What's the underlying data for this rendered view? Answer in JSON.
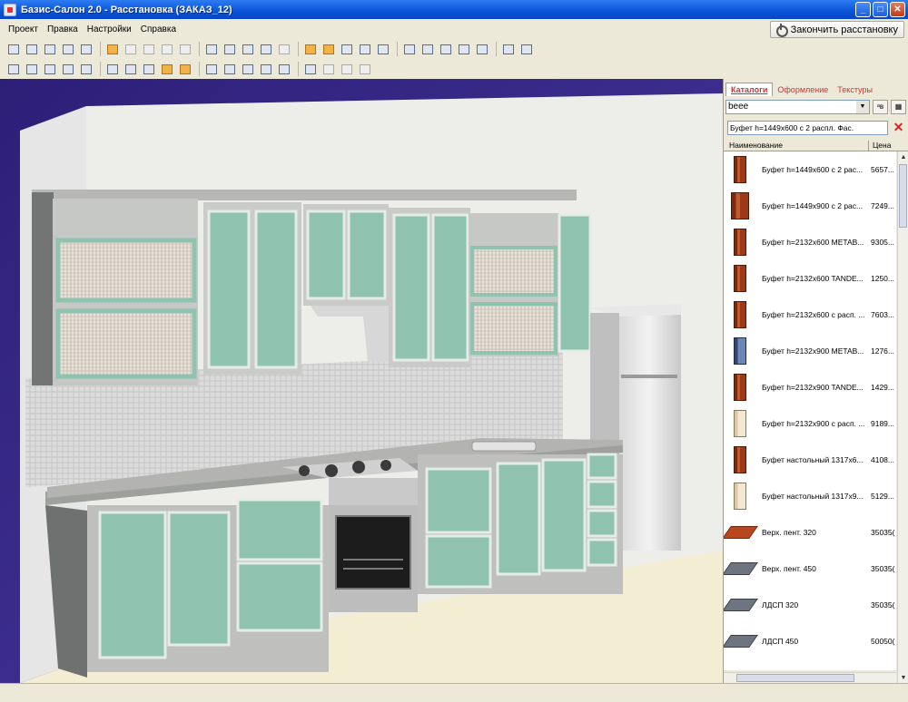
{
  "window": {
    "title": "Базис-Салон 2.0 -  Расстановка (ЗАКАЗ_12)",
    "controls": {
      "minimize": "_",
      "maximize": "□",
      "close": "✕"
    }
  },
  "menu": [
    "Проект",
    "Правка",
    "Настройки",
    "Справка"
  ],
  "finish_button": "Закончить расстановку",
  "toolbar_icons": {
    "row1": [
      "new-icon",
      "open-icon",
      "save-icon",
      "print-icon",
      "home-icon",
      "undo-icon",
      "redo-icon",
      "cut-icon",
      "copy-icon",
      "paste-icon",
      "select-icon",
      "grid-icon",
      "table-icon",
      "chart-icon",
      "dimension-icon",
      "box-icon",
      "shelf-icon",
      "lamp-icon",
      "group-icon",
      "place-icon",
      "move-icon",
      "catalog-icon",
      "pencil-icon",
      "measure-icon",
      "paint-icon",
      "calendar-icon",
      "report-icon"
    ],
    "row2": [
      "zoom-icon",
      "view-front-icon",
      "view-left-icon",
      "view-right-icon",
      "view-top-icon",
      "view-back-icon",
      "view-iso-icon",
      "wire-icon",
      "shade-icon",
      "solid-icon",
      "camera-icon",
      "light-icon",
      "snap-icon",
      "magnet-icon",
      "move-axis-icon",
      "rotate-icon",
      "mirror-icon",
      "align-icon",
      "dim-icon"
    ]
  },
  "panel": {
    "tabs": [
      "Каталоги",
      "Оформление",
      "Текстуры"
    ],
    "active_tab": "Каталоги",
    "catalog_select": "beee",
    "filter_text": "Буфет h=1449x600 с 2 распл. Фас.",
    "columns": {
      "name": "Наименование",
      "price": "Цена"
    },
    "items": [
      {
        "name": "Буфет h=1449x600 с 2 рас...",
        "price": "5657...",
        "thumb": "cab"
      },
      {
        "name": "Буфет h=1449x900 с 2 рас...",
        "price": "7249...",
        "thumb": "cab-wide"
      },
      {
        "name": "Буфет h=2132x600 METAB...",
        "price": "9305...",
        "thumb": "cab"
      },
      {
        "name": "Буфет h=2132x600 TANDE...",
        "price": "1250...",
        "thumb": "cab"
      },
      {
        "name": "Буфет h=2132x600 с расп. ...",
        "price": "7603...",
        "thumb": "cab"
      },
      {
        "name": "Буфет h=2132x900 METAB...",
        "price": "1276...",
        "thumb": "cab-blue"
      },
      {
        "name": "Буфет h=2132x900 TANDE...",
        "price": "1429...",
        "thumb": "cab"
      },
      {
        "name": "Буфет h=2132x900 с расп. ...",
        "price": "9189...",
        "thumb": "cab-light"
      },
      {
        "name": "Буфет настольный 1317x6...",
        "price": "4108...",
        "thumb": "cab"
      },
      {
        "name": "Буфет настольный 1317x9...",
        "price": "5129...",
        "thumb": "cab-light"
      },
      {
        "name": "Верх. пент. 320",
        "price": "35035(",
        "thumb": "slab"
      },
      {
        "name": "Верх. пент. 450",
        "price": "35035(",
        "thumb": "slab-gray"
      },
      {
        "name": "ЛДСП 320",
        "price": "35035(",
        "thumb": "slab-gray"
      },
      {
        "name": "ЛДСП 450",
        "price": "50050(",
        "thumb": "slab-gray"
      }
    ]
  },
  "colors": {
    "viewport_sky": "#3b2787",
    "facade": "#8fc3b0",
    "carcass": "#bfc0bd",
    "countertop": "#9ea09d",
    "floor": "#f3edd3"
  }
}
